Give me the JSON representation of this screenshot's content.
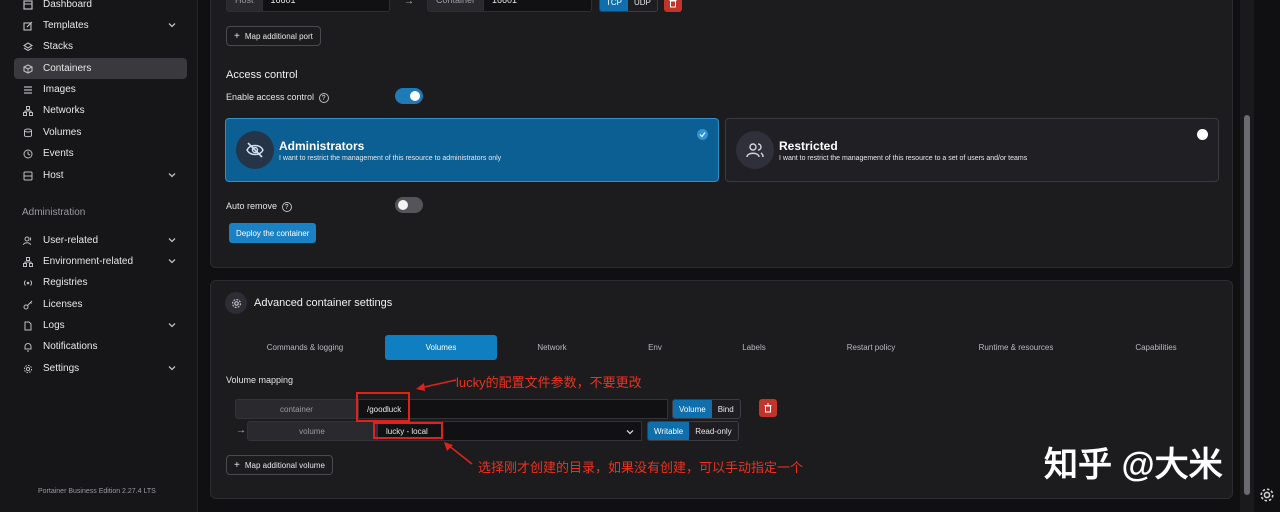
{
  "sidebar": {
    "items": [
      {
        "label": "Dashboard",
        "icon": "dashboard-icon"
      },
      {
        "label": "Templates",
        "icon": "edit-icon",
        "expandable": true
      },
      {
        "label": "Stacks",
        "icon": "layers-icon"
      },
      {
        "label": "Containers",
        "icon": "box-icon",
        "active": true
      },
      {
        "label": "Images",
        "icon": "list-icon"
      },
      {
        "label": "Networks",
        "icon": "network-icon"
      },
      {
        "label": "Volumes",
        "icon": "database-icon"
      },
      {
        "label": "Events",
        "icon": "clock-icon"
      },
      {
        "label": "Host",
        "icon": "server-icon",
        "expandable": true
      }
    ],
    "admin_title": "Administration",
    "admin_items": [
      {
        "label": "User-related",
        "icon": "users-icon",
        "expandable": true
      },
      {
        "label": "Environment-related",
        "icon": "network-icon",
        "expandable": true
      },
      {
        "label": "Registries",
        "icon": "radio-icon"
      },
      {
        "label": "Licenses",
        "icon": "key-icon"
      },
      {
        "label": "Logs",
        "icon": "file-icon",
        "expandable": true
      },
      {
        "label": "Notifications",
        "icon": "bell-icon"
      },
      {
        "label": "Settings",
        "icon": "gear-icon",
        "expandable": true
      }
    ],
    "footer": "Portainer Business Edition 2.27.4 LTS"
  },
  "ports": {
    "host_label": "Host",
    "host_value": "16601",
    "container_label": "Container",
    "container_value": "16601",
    "tcp": "TCP",
    "udp": "UDP",
    "map_port_label": "Map additional port"
  },
  "access": {
    "title": "Access control",
    "enable_label": "Enable access control",
    "admin_title": "Administrators",
    "admin_desc": "I want to restrict the management of this resource to administrators only",
    "restricted_title": "Restricted",
    "restricted_desc": "I want to restrict the management of this resource to a set of users and/or teams",
    "auto_remove_label": "Auto remove",
    "deploy_label": "Deploy the container"
  },
  "advanced": {
    "title": "Advanced container settings",
    "tabs": [
      "Commands & logging",
      "Volumes",
      "Network",
      "Env",
      "Labels",
      "Restart policy",
      "Runtime & resources",
      "Capabilities"
    ],
    "active_tab": "Volumes",
    "volume_mapping_label": "Volume mapping",
    "container_prefix": "container",
    "container_value": "/goodluck",
    "volume_btn": "Volume",
    "bind_btn": "Bind",
    "volume_prefix": "volume",
    "volume_value": "lucky - local",
    "writable_btn": "Writable",
    "readonly_btn": "Read-only",
    "map_volume_label": "Map additional volume"
  },
  "annotations": {
    "note1": "lucky的配置文件参数，不要更改",
    "note2": "选择刚才创建的目录，如果没有创建，可以手动指定一个"
  },
  "watermark": "知乎 @大米",
  "colors": {
    "accent": "#1a82c4",
    "annotation": "#e0221c",
    "danger": "#c0342a"
  }
}
